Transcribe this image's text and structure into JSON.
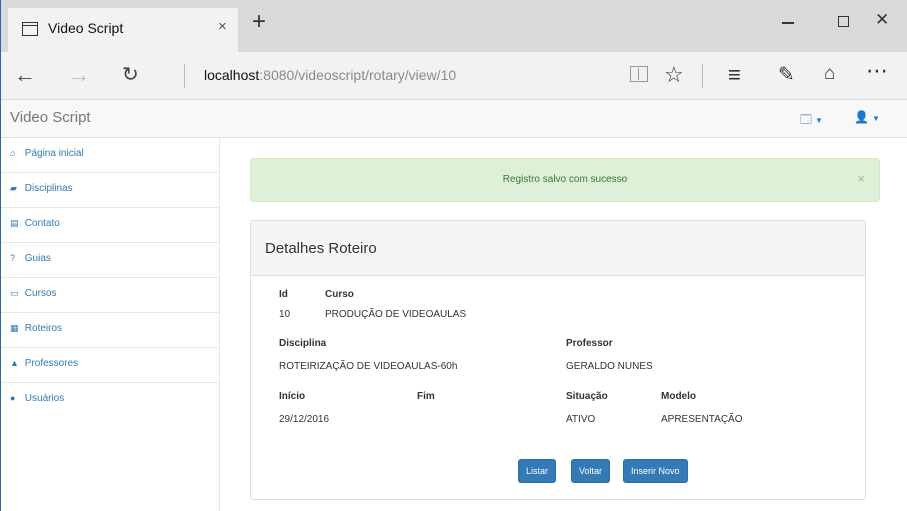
{
  "browser": {
    "tab_title": "Video Script",
    "tab_close": "×",
    "new_tab": "+",
    "url_host": "localhost",
    "url_rest": ":8080/videoscript/rotary/view/10",
    "icons": [
      "back-icon",
      "forward-icon",
      "refresh-icon",
      "reading-view-icon",
      "star-icon",
      "hub-icon",
      "web-note-icon",
      "share-icon",
      "more-icon"
    ]
  },
  "app": {
    "brand": "Video Script",
    "lang_menu": "🗔",
    "user_menu": "👤"
  },
  "sidebar": {
    "items": [
      {
        "icon": "home-icon",
        "glyph": "⌂",
        "label": "Página inicial"
      },
      {
        "icon": "book-icon",
        "glyph": "▰",
        "label": "Disciplinas"
      },
      {
        "icon": "contact-icon",
        "glyph": "▤",
        "label": "Contato"
      },
      {
        "icon": "help-icon",
        "glyph": "?",
        "label": "Guias"
      },
      {
        "icon": "courses-icon",
        "glyph": "▭",
        "label": "Cursos"
      },
      {
        "icon": "script-icon",
        "glyph": "▦",
        "label": "Roteiros"
      },
      {
        "icon": "teachers-icon",
        "glyph": "▲",
        "label": "Professores"
      },
      {
        "icon": "user-icon",
        "glyph": "●",
        "label": "Usuários"
      }
    ]
  },
  "alert": {
    "text": "Registro salvo com sucesso",
    "close": "×"
  },
  "panel": {
    "title": "Detalhes Roteiro",
    "id_label": "Id",
    "id_value": "10",
    "curso_label": "Curso",
    "curso_value": "PRODUÇÃO DE VIDEOAULAS",
    "disciplina_label": "Disciplina",
    "disciplina_value": "ROTEIRIZAÇÃO DE VIDEOAULAS-60h",
    "professor_label": "Professor",
    "professor_value": "GERALDO NUNES",
    "inicio_label": "Início",
    "inicio_value": "29/12/2016",
    "fim_label": "Fim",
    "fim_value": "",
    "situacao_label": "Situação",
    "situacao_value": "ATIVO",
    "modelo_label": "Modelo",
    "modelo_value": "APRESENTAÇÃO",
    "buttons": {
      "listar": "Listar",
      "voltar": "Voltar",
      "inserir": "Inserir Novo"
    }
  },
  "colors": {
    "primary": "#337ab7",
    "alert_bg": "#dff0d8",
    "alert_text": "#3c763d"
  }
}
